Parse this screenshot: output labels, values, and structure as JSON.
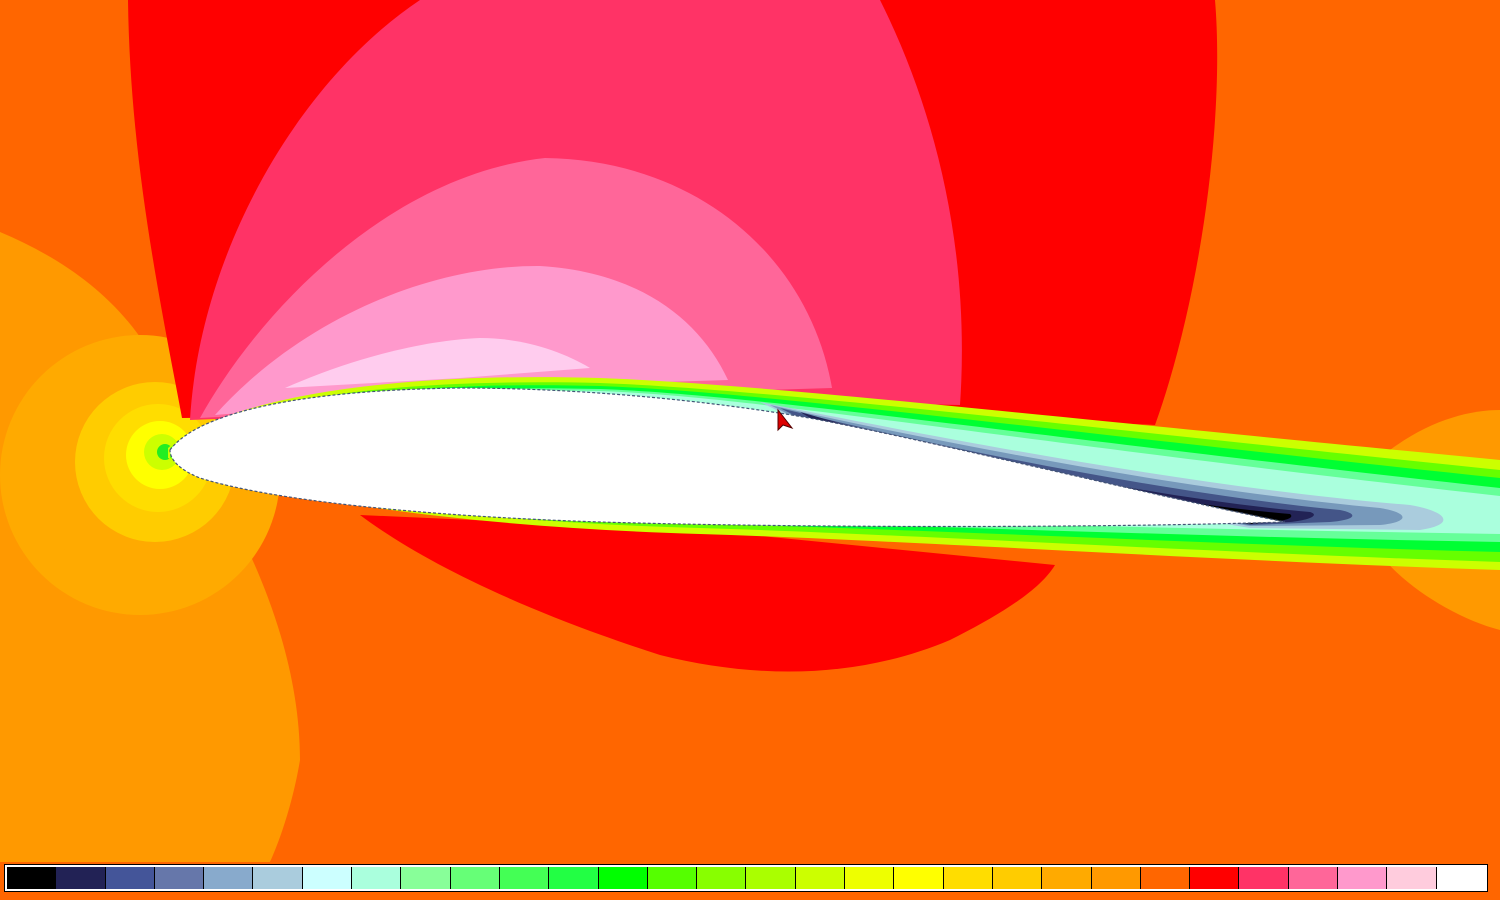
{
  "colors": {
    "freestream": "#ff6600",
    "stagnation_bands": [
      "#ff9900",
      "#ffaa00",
      "#ffcc00",
      "#ffdd00",
      "#ffff00",
      "#22ee22"
    ],
    "suction_bands": [
      "#ff0000",
      "#ff3366",
      "#ff6699",
      "#ff99cc",
      "#ffccee"
    ],
    "boundary_layer": [
      "#ccff00",
      "#66ff00",
      "#00ff33",
      "#66ff99",
      "#aaffdd",
      "#ccffff"
    ],
    "separated_wake": [
      "#aaccdd",
      "#7799bb",
      "#445588",
      "#222255",
      "#000000"
    ],
    "airfoil_fill": "#ffffff"
  },
  "colorbar": {
    "levels": [
      "#000000",
      "#222255",
      "#445599",
      "#6677aa",
      "#88aacc",
      "#aaccdd",
      "#ccffff",
      "#aaffdd",
      "#88ff99",
      "#66ff77",
      "#44ff55",
      "#22ff44",
      "#00ff00",
      "#55ff00",
      "#88ff00",
      "#aaff00",
      "#ccff00",
      "#eeff00",
      "#ffff00",
      "#ffdd00",
      "#ffcc00",
      "#ffaa00",
      "#ff9900",
      "#ff6600",
      "#ff0000",
      "#ff3366",
      "#ff6699",
      "#ff99cc",
      "#ffccdd",
      "#ffffff"
    ]
  },
  "cursor": {
    "icon": "arrow-cursor-icon",
    "color": "#dd0000"
  }
}
